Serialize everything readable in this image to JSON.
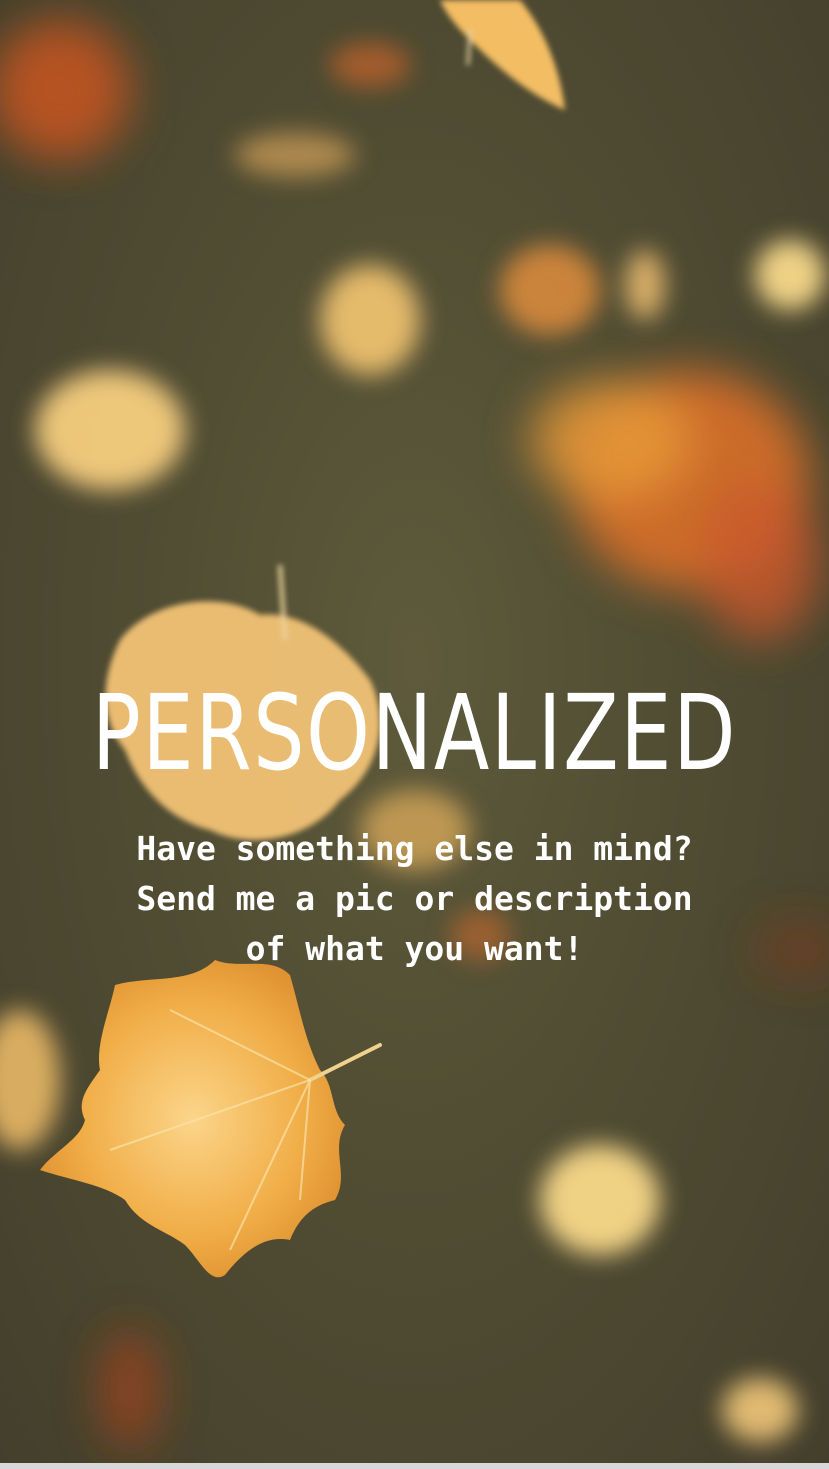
{
  "story": {
    "title": "PERSONALIZED",
    "caption": "Have something else in mind?\nSend me a pic or description\nof what you want!",
    "background": "autumn-leaves-photo",
    "colors": {
      "background_dark": "#4d4a33",
      "leaf_yellow": "#f2b85a",
      "leaf_orange": "#e0842e",
      "leaf_red": "#c85a22",
      "text": "#ffffff"
    }
  }
}
